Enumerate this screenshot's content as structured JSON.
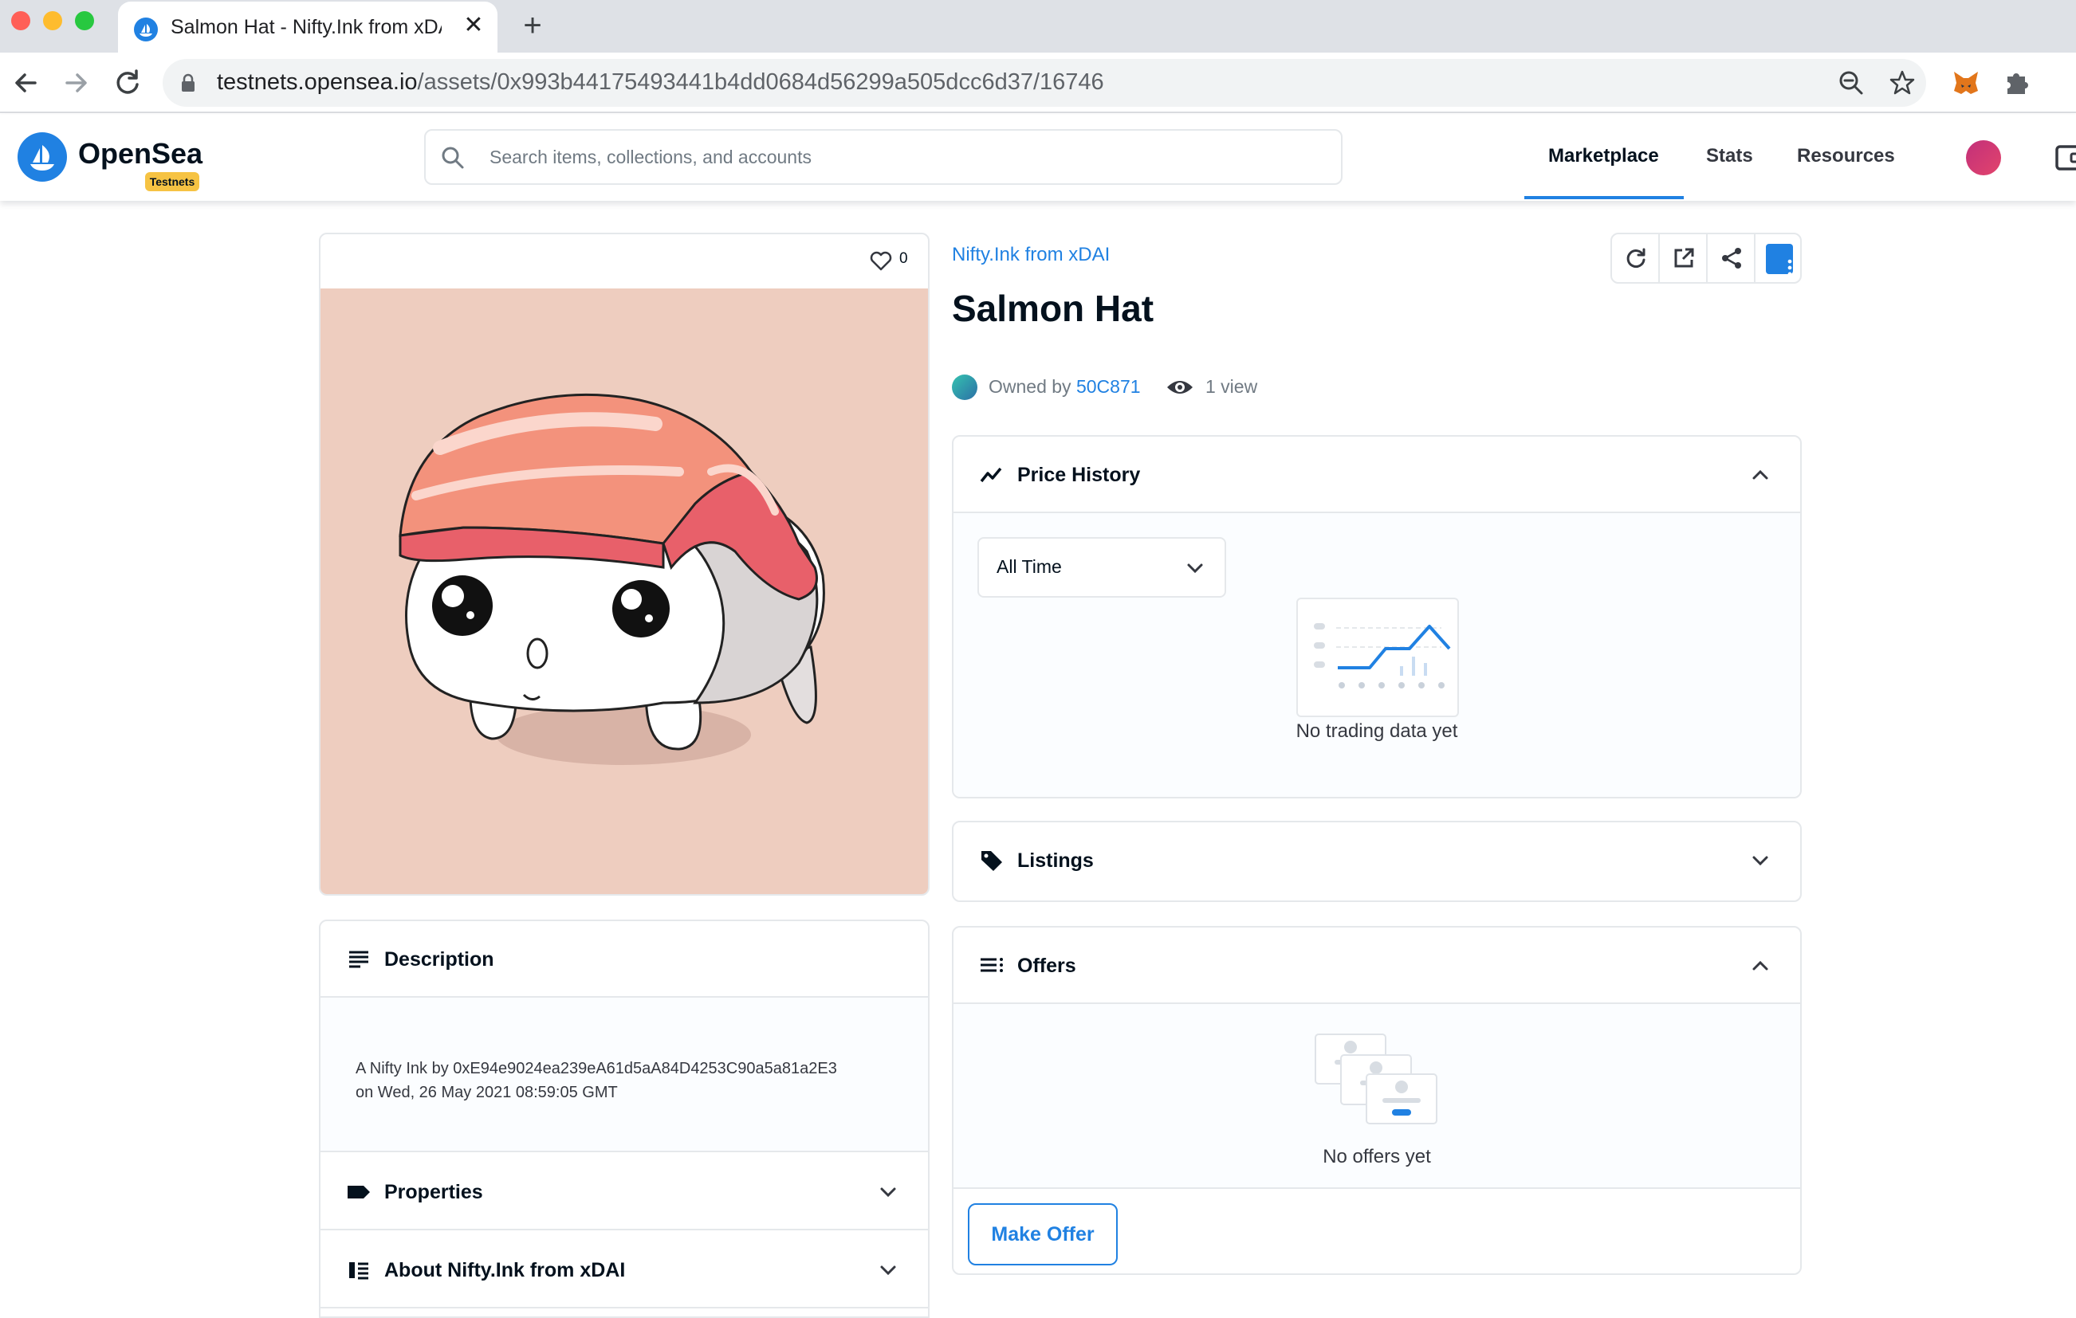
{
  "browser": {
    "tab_title": "Salmon Hat - Nifty.Ink from xDAI",
    "new_tab_glyph": "+",
    "close_glyph": "✕",
    "url_host": "testnets.opensea.io",
    "url_path": "/assets/0x993b44175493441b4dd0684d56299a505dcc6d37/16746"
  },
  "header": {
    "logo_text": "OpenSea",
    "badge": "Testnets",
    "search_placeholder": "Search items, collections, and accounts",
    "nav": [
      "Marketplace",
      "Stats",
      "Resources"
    ],
    "active_nav": "Marketplace",
    "accent_color": "#2081e2"
  },
  "asset": {
    "favorites_count": "0",
    "collection": "Nifty.Ink from xDAI",
    "title": "Salmon Hat",
    "owned_by_prefix": "Owned by",
    "owner": "50C871",
    "views": "1 view"
  },
  "sections": {
    "description": {
      "label": "Description",
      "text_line1": "A Nifty Ink by 0xE94e9024ea239eA61d5aA84D4253C90a5a81a2E3",
      "text_line2": "on Wed, 26 May 2021 08:59:05 GMT"
    },
    "properties": {
      "label": "Properties"
    },
    "about": {
      "label": "About Nifty.Ink from xDAI"
    },
    "price_history": {
      "label": "Price History",
      "range_selected": "All Time",
      "empty_text": "No trading data yet"
    },
    "listings": {
      "label": "Listings"
    },
    "offers": {
      "label": "Offers",
      "empty_text": "No offers yet",
      "button": "Make Offer"
    }
  },
  "icons": {
    "back": "arrow-left-icon",
    "forward": "arrow-right-icon",
    "reload": "reload-icon",
    "lock": "lock-icon",
    "zoom": "zoom-out-icon",
    "star": "bookmark-star-icon",
    "metamask": "metamask-fox-icon",
    "extensions": "puzzle-icon",
    "search": "search-icon",
    "heart": "heart-icon",
    "refresh": "refresh-icon",
    "external": "external-link-icon",
    "share": "share-icon",
    "more": "more-vertical-icon",
    "eye": "eye-icon"
  }
}
